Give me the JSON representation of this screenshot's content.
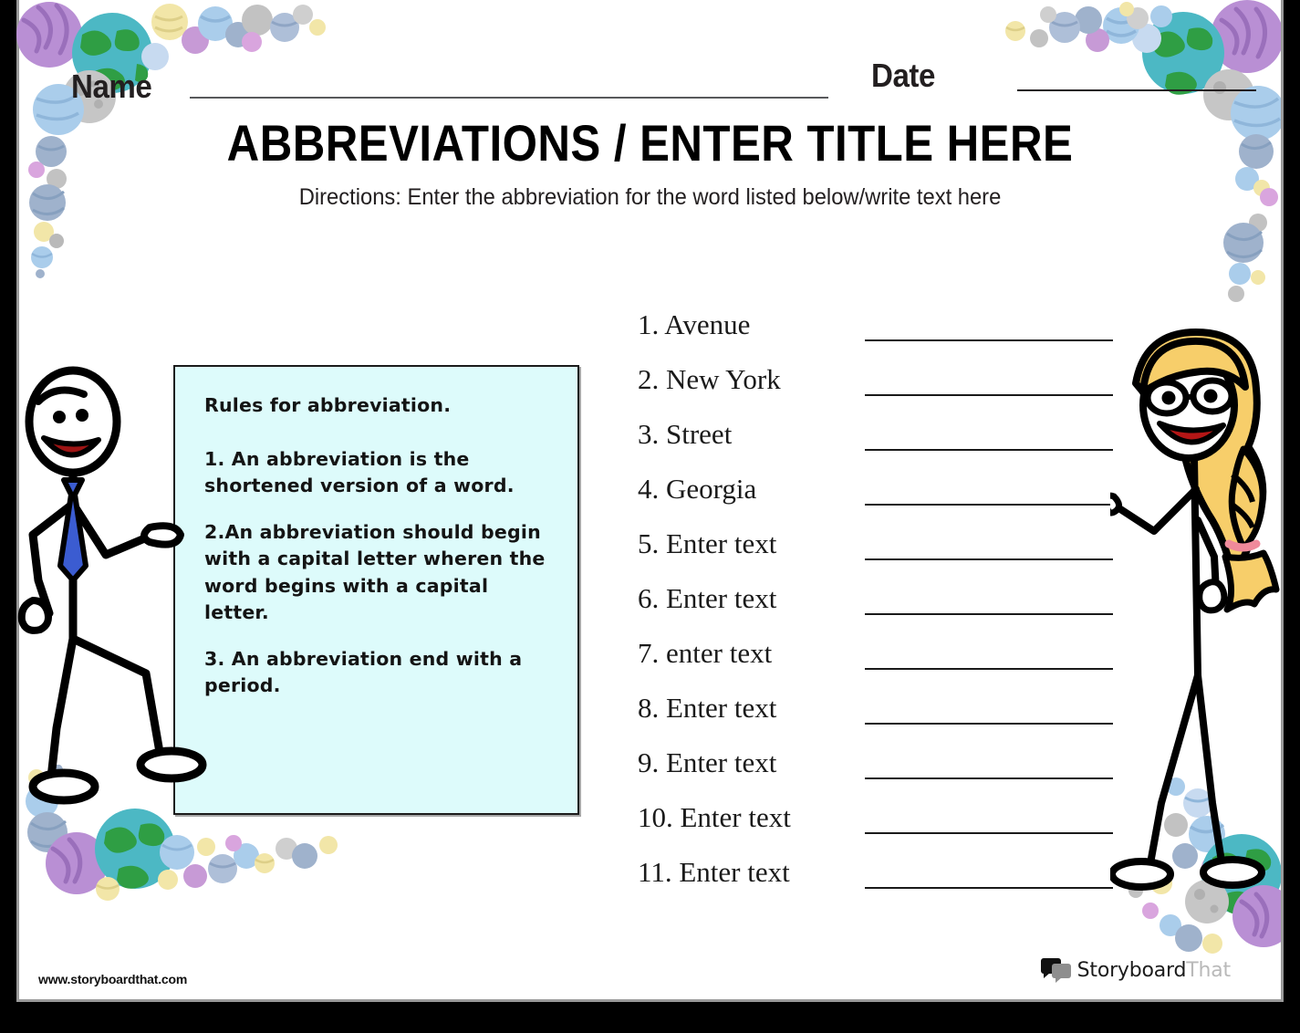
{
  "header": {
    "name_label": "Name",
    "date_label": "Date",
    "title": "ABBREVIATIONS / ENTER TITLE HERE",
    "directions": "Directions: Enter the abbreviation for the word listed below/write text here"
  },
  "rules_box": {
    "background_color": "#ddfbfb",
    "border_color": "#1b1b1b",
    "lines": [
      "Rules for abbreviation.",
      "1. An abbreviation is the shortened version of a word.",
      "2.An abbreviation should begin with a capital letter wheren the word begins with a capital letter.",
      "3. An abbreviation end with a period."
    ]
  },
  "questions": [
    {
      "number": "1.",
      "text": "Avenue"
    },
    {
      "number": "2.",
      "text": "New York"
    },
    {
      "number": "3.",
      "text": "Street"
    },
    {
      "number": "4.",
      "text": "Georgia"
    },
    {
      "number": "5.",
      "text": "Enter text"
    },
    {
      "number": "6.",
      "text": "Enter text"
    },
    {
      "number": "7.",
      "text": "enter text"
    },
    {
      "number": "8.",
      "text": "Enter text"
    },
    {
      "number": "9.",
      "text": "Enter text"
    },
    {
      "number": "10.",
      "text": "Enter text"
    },
    {
      "number": "11.",
      "text": "Enter text"
    }
  ],
  "questions_display": [
    "1. Avenue",
    "2. New York",
    "3. Street",
    "4. Georgia",
    "5. Enter text",
    "6. Enter text",
    "7. enter text",
    "8. Enter text",
    "9. Enter text",
    "10. Enter text",
    "11. Enter text"
  ],
  "footer": {
    "site_url": "www.storyboardthat.com",
    "logo_word1": "Storyboard",
    "logo_word2": "That"
  },
  "decoration": {
    "theme": "planets-and-globes",
    "colors": {
      "earth_ocean": "#4cb8c4",
      "earth_land": "#2f9e44",
      "purple_planet": "#b98fd4",
      "light_blue_planet": "#aacdeb",
      "gray_moon": "#bcbcbc",
      "yellow_planet": "#f2e6a8",
      "slate_planet": "#9fb2cc",
      "pink_planet": "#d9a5de"
    }
  },
  "characters": {
    "left": {
      "name": "boy-stick-figure",
      "tie_color": "#3b5cd1",
      "mouth_color": "#9e1414"
    },
    "right": {
      "name": "girl-stick-figure",
      "hair_color": "#f7ce6a",
      "mouth_color": "#b41616",
      "hair_tie_color": "#f08a9b"
    }
  }
}
